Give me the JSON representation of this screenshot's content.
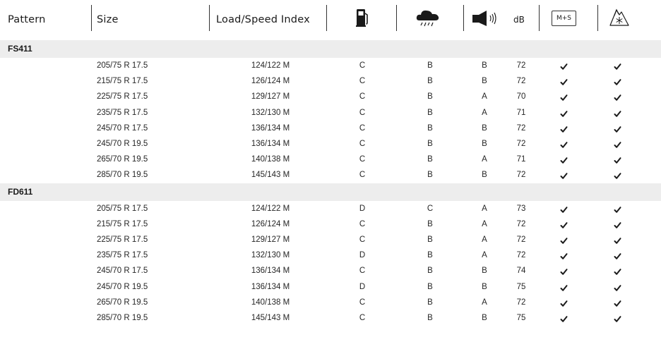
{
  "header": {
    "pattern": "Pattern",
    "size": "Size",
    "load_speed_index": "Load/Speed Index",
    "db": "dB",
    "ms_badge": "M+S",
    "icons": [
      "fuel-pump-icon",
      "rain-cloud-icon",
      "speaker-icon",
      "mountain-snowflake-icon"
    ]
  },
  "groups": [
    {
      "name": "FS411",
      "rows": [
        {
          "size": "205/75 R 17.5",
          "index": "124/122 M",
          "fuel": "C",
          "wet": "B",
          "noise": "B",
          "db": "72",
          "ms": true,
          "snow": true
        },
        {
          "size": "215/75 R 17.5",
          "index": "126/124 M",
          "fuel": "C",
          "wet": "B",
          "noise": "B",
          "db": "72",
          "ms": true,
          "snow": true
        },
        {
          "size": "225/75 R 17.5",
          "index": "129/127 M",
          "fuel": "C",
          "wet": "B",
          "noise": "A",
          "db": "70",
          "ms": true,
          "snow": true
        },
        {
          "size": "235/75 R 17.5",
          "index": "132/130 M",
          "fuel": "C",
          "wet": "B",
          "noise": "A",
          "db": "71",
          "ms": true,
          "snow": true
        },
        {
          "size": "245/70 R 17.5",
          "index": "136/134 M",
          "fuel": "C",
          "wet": "B",
          "noise": "B",
          "db": "72",
          "ms": true,
          "snow": true
        },
        {
          "size": "245/70 R 19.5",
          "index": "136/134 M",
          "fuel": "C",
          "wet": "B",
          "noise": "B",
          "db": "72",
          "ms": true,
          "snow": true
        },
        {
          "size": "265/70 R 19.5",
          "index": "140/138 M",
          "fuel": "C",
          "wet": "B",
          "noise": "A",
          "db": "71",
          "ms": true,
          "snow": true
        },
        {
          "size": "285/70 R 19.5",
          "index": "145/143 M",
          "fuel": "C",
          "wet": "B",
          "noise": "B",
          "db": "72",
          "ms": true,
          "snow": true
        }
      ]
    },
    {
      "name": "FD611",
      "rows": [
        {
          "size": "205/75 R 17.5",
          "index": "124/122 M",
          "fuel": "D",
          "wet": "C",
          "noise": "A",
          "db": "73",
          "ms": true,
          "snow": true
        },
        {
          "size": "215/75 R 17.5",
          "index": "126/124 M",
          "fuel": "C",
          "wet": "B",
          "noise": "A",
          "db": "72",
          "ms": true,
          "snow": true
        },
        {
          "size": "225/75 R 17.5",
          "index": "129/127 M",
          "fuel": "C",
          "wet": "B",
          "noise": "A",
          "db": "72",
          "ms": true,
          "snow": true
        },
        {
          "size": "235/75 R 17.5",
          "index": "132/130 M",
          "fuel": "D",
          "wet": "B",
          "noise": "A",
          "db": "72",
          "ms": true,
          "snow": true
        },
        {
          "size": "245/70 R 17.5",
          "index": "136/134 M",
          "fuel": "C",
          "wet": "B",
          "noise": "B",
          "db": "74",
          "ms": true,
          "snow": true
        },
        {
          "size": "245/70 R 19.5",
          "index": "136/134 M",
          "fuel": "D",
          "wet": "B",
          "noise": "B",
          "db": "75",
          "ms": true,
          "snow": true
        },
        {
          "size": "265/70 R 19.5",
          "index": "140/138 M",
          "fuel": "C",
          "wet": "B",
          "noise": "A",
          "db": "72",
          "ms": true,
          "snow": true
        },
        {
          "size": "285/70 R 19.5",
          "index": "145/143 M",
          "fuel": "C",
          "wet": "B",
          "noise": "B",
          "db": "75",
          "ms": true,
          "snow": true
        }
      ]
    }
  ]
}
